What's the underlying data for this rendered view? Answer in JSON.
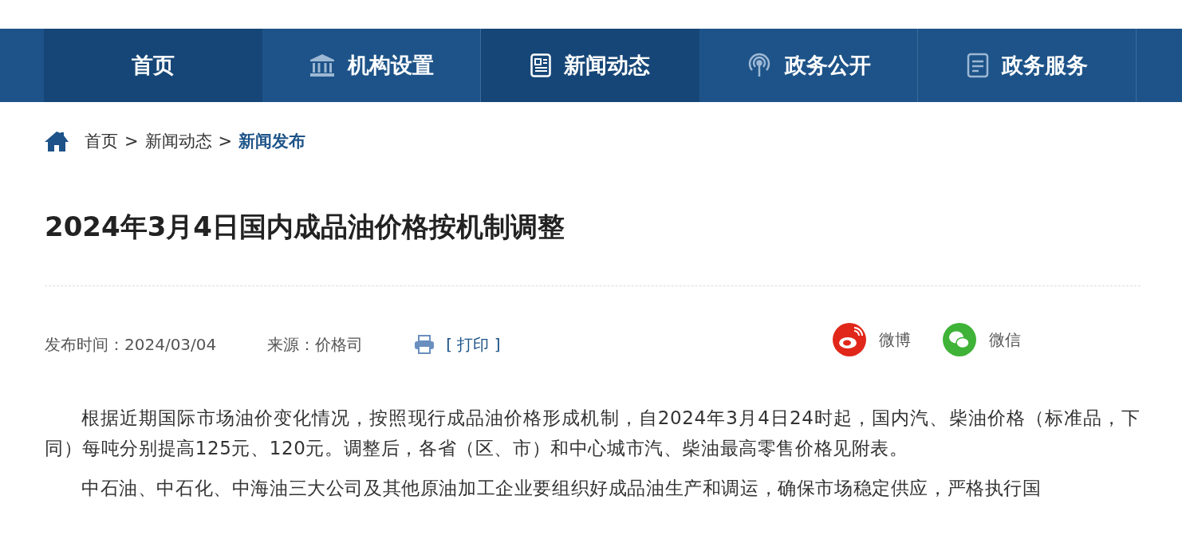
{
  "nav": [
    {
      "label": "首页",
      "kind": "plain",
      "selected": true
    },
    {
      "label": "机构设置",
      "kind": "building",
      "selected": false
    },
    {
      "label": "新闻动态",
      "kind": "news",
      "selected": true
    },
    {
      "label": "政务公开",
      "kind": "signal",
      "selected": false
    },
    {
      "label": "政务服务",
      "kind": "document",
      "selected": false
    }
  ],
  "breadcrumb": [
    {
      "label": "首页",
      "current": false
    },
    {
      "label": "新闻动态",
      "current": false
    },
    {
      "label": "新闻发布",
      "current": true
    }
  ],
  "breadcrumb_separator": ">",
  "article": {
    "title": "2024年3月4日国内成品油价格按机制调整",
    "published": "发布时间：2024/03/04",
    "source": "来源：价格司",
    "print": "[ 打印 ]",
    "share": [
      {
        "label": "微博",
        "kind": "weibo",
        "color": "#e0271a"
      },
      {
        "label": "微信",
        "kind": "wechat",
        "color": "#3fb337"
      }
    ],
    "paragraphs": [
      "根据近期国际市场油价变化情况，按照现行成品油价格形成机制，自2024年3月4日24时起，国内汽、柴油价格（标准品，下同）每吨分别提高125元、120元。调整后，各省（区、市）和中心城市汽、柴油最高零售价格见附表。",
      "中石油、中石化、中海油三大公司及其他原油加工企业要组织好成品油生产和调运，确保市场稳定供应，严格执行国"
    ]
  }
}
